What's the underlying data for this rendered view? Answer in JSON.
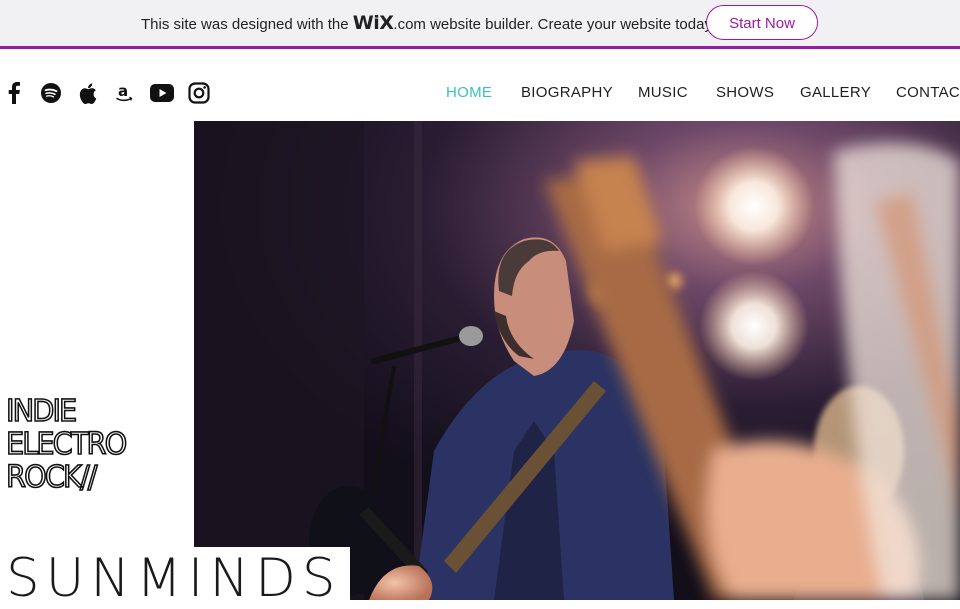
{
  "banner": {
    "text_before": "This site was designed with the ",
    "logo": "WiX",
    "logo_suffix": ".com",
    "text_after": " website builder. Create your website today.",
    "cta": "Start Now",
    "accent": "#9b1aa5"
  },
  "social": {
    "icons": [
      "facebook-icon",
      "spotify-icon",
      "apple-icon",
      "amazon-icon",
      "youtube-icon",
      "instagram-icon"
    ]
  },
  "nav": {
    "items": [
      "HOME",
      "BIOGRAPHY",
      "MUSIC",
      "SHOWS",
      "GALLERY",
      "CONTACT"
    ],
    "active": "HOME",
    "active_color": "#3cc1b7"
  },
  "hero": {
    "tagline": [
      "INDIE",
      "ELECTRO",
      "ROCK//"
    ],
    "brand": "SUNMINDS",
    "image": "singer-with-microphone-photo"
  }
}
